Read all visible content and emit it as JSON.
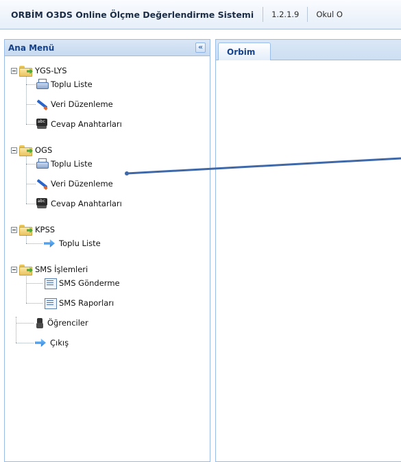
{
  "topbar": {
    "title": "ORBİM O3DS Online Ölçme Değerlendirme Sistemi",
    "version": "1.2.1.9",
    "school_label": "Okul O"
  },
  "sidebar": {
    "title": "Ana Menü",
    "collapse_symbol": "«",
    "tree": [
      {
        "label": "YGS-LYS",
        "icon": "folder-icon",
        "children": [
          {
            "label": "Toplu Liste",
            "icon": "printer-icon"
          },
          {
            "label": "Veri Düzenleme",
            "icon": "pencil-icon"
          },
          {
            "label": "Cevap Anahtarları",
            "icon": "answer-key-icon"
          }
        ]
      },
      {
        "label": "OGS",
        "icon": "folder-icon",
        "children": [
          {
            "label": "Toplu Liste",
            "icon": "printer-icon"
          },
          {
            "label": "Veri Düzenleme",
            "icon": "pencil-icon"
          },
          {
            "label": "Cevap Anahtarları",
            "icon": "answer-key-icon"
          }
        ]
      },
      {
        "label": "KPSS",
        "icon": "folder-icon",
        "children": [
          {
            "label": "Toplu Liste",
            "icon": "arrow-icon"
          }
        ]
      },
      {
        "label": "SMS İşlemleri",
        "icon": "folder-icon",
        "children": [
          {
            "label": "SMS Gönderme",
            "icon": "sms-icon"
          },
          {
            "label": "SMS Raporları",
            "icon": "sms-icon"
          }
        ]
      },
      {
        "label": "Öğrenciler",
        "icon": "student-icon"
      },
      {
        "label": "Çıkış",
        "icon": "arrow-icon"
      }
    ]
  },
  "content": {
    "tabs": [
      {
        "label": "Orbim",
        "active": true
      }
    ]
  },
  "colors": {
    "panel_border": "#99bbe8",
    "header_text": "#15428b",
    "annotation_line": "#3f68a8"
  }
}
